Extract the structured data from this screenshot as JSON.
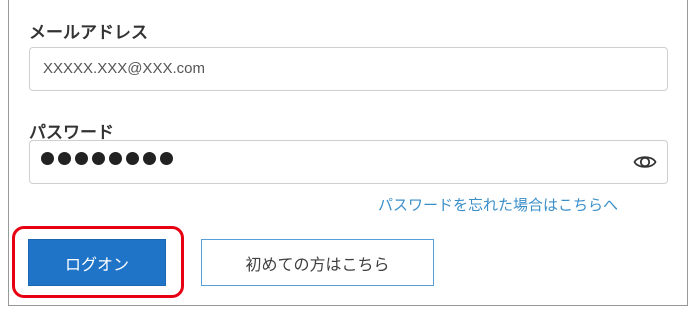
{
  "login_form": {
    "email_label": "メールアドレス",
    "email_value": "XXXXX.XXX@XXX.com",
    "password_label": "パスワード",
    "password_masked": "●●●●●●●●",
    "password_length": 8,
    "forgot_password_link": "パスワードを忘れた場合はこちらへ",
    "logon_button": "ログオン",
    "first_time_button": "初めての方はこちら"
  },
  "icons": {
    "show_password": "eye-icon"
  },
  "colors": {
    "primary_button": "#1f74c8",
    "link": "#3a8fc9",
    "highlight": "#e60012",
    "secondary_button_border": "#5a9fd6"
  }
}
